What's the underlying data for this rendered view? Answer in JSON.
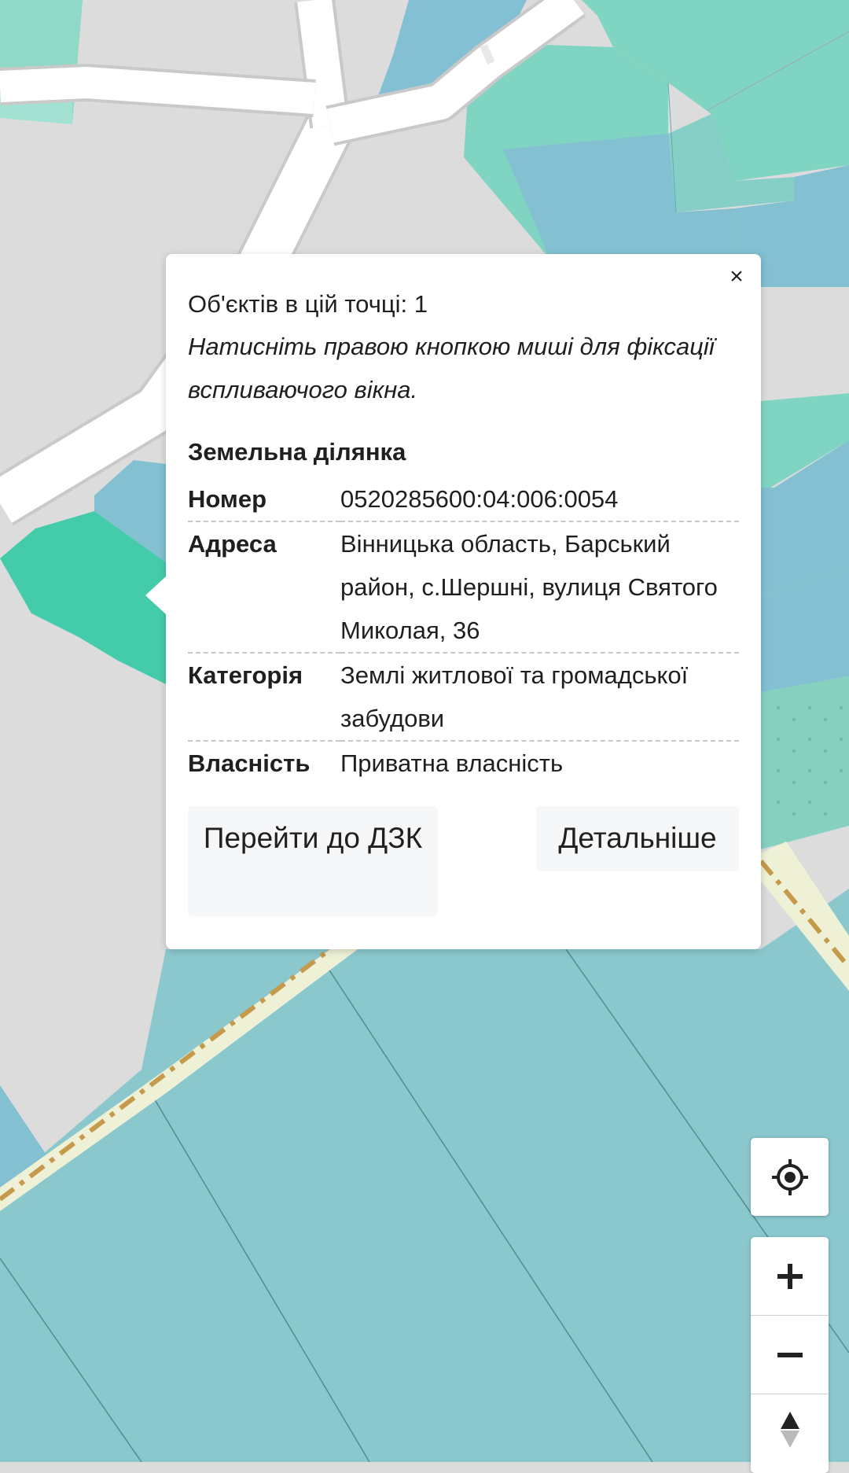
{
  "popup": {
    "close_label": "×",
    "objects_count": "Об'єктів в цій точці: 1",
    "hint": "Натисніть правою кнопкою миші для фіксації вспливаючого вікна.",
    "section_title": "Земельна ділянка",
    "properties": [
      {
        "key": "Номер",
        "value": "0520285600:04:006:0054"
      },
      {
        "key": "Адреса",
        "value": "Вінницька область, Барський район, с.Шершні, вулиця Святого Миколая, 36"
      },
      {
        "key": "Категорія",
        "value": "Землі житлової та громадської забудови"
      },
      {
        "key": "Власність",
        "value": "Приватна власність"
      }
    ],
    "button_dzk": "Перейти до ДЗК",
    "button_details": "Детальніше"
  },
  "controls": {
    "locate_icon": "crosshair-locate-icon",
    "zoom_in_icon": "plus-icon",
    "zoom_out_icon": "minus-icon",
    "compass_icon": "compass-arrows-icon"
  },
  "colors": {
    "map_background": "#dcdcdc",
    "parcel_teal": "#80d4c2",
    "parcel_blue": "#82c0d2",
    "parcel_green": "#44ccaa",
    "parcel_cyan": "#8ac8ce",
    "road": "#ffffff",
    "boundary_dash": "#c69a4c"
  }
}
